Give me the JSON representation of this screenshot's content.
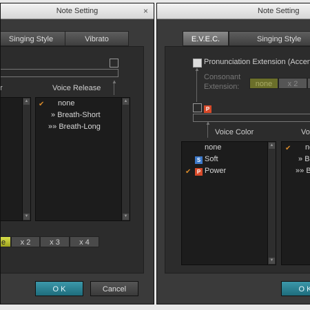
{
  "left_window": {
    "title": "Note Setting",
    "close_label": "×",
    "tabs": [
      {
        "label": "Singing Style"
      },
      {
        "label": "Vibrato"
      }
    ],
    "voice_release_header": "Voice Release",
    "left_list_header": "r",
    "voice_release_items": [
      {
        "prefix": "",
        "label": "none",
        "checked": true
      },
      {
        "prefix": "»",
        "label": "Breath-Short",
        "checked": false
      },
      {
        "prefix": "»»",
        "label": "Breath-Long",
        "checked": false
      }
    ],
    "multiplier_options": [
      {
        "label": "e",
        "selected": true
      },
      {
        "label": "x 2",
        "selected": false
      },
      {
        "label": "x 3",
        "selected": false
      },
      {
        "label": "x 4",
        "selected": false
      }
    ],
    "ok_label": "O K",
    "cancel_label": "Cancel"
  },
  "right_window": {
    "title": "Note Setting",
    "tabs": [
      {
        "label": "E.V.E.C."
      },
      {
        "label": "Singing Style"
      }
    ],
    "pronunciation_label": "Pronunciation Extension (Accen",
    "consonant_label_1": "Consonant",
    "consonant_label_2": "Extension:",
    "consonant_options": [
      {
        "label": "none",
        "selected": true
      },
      {
        "label": "x 2",
        "selected": false
      },
      {
        "label": "",
        "selected": false
      }
    ],
    "p_badge": "P",
    "voice_color_header": "Voice Color",
    "second_header": "Vo",
    "voice_color_items": [
      {
        "badge": "",
        "label": "none",
        "checked": false
      },
      {
        "badge": "S",
        "label": "Soft",
        "checked": false
      },
      {
        "badge": "P",
        "label": "Power",
        "checked": true
      }
    ],
    "second_list_items": [
      {
        "prefix": "",
        "label": "no",
        "checked": true
      },
      {
        "prefix": "»",
        "label": "Br",
        "checked": false
      },
      {
        "prefix": "»»",
        "label": "Br",
        "checked": false
      }
    ],
    "ok_label": "O K"
  },
  "colors": {
    "accent_yellow": "#c9d03a",
    "ok_teal": "#2a8597",
    "check_orange": "#d88a2a",
    "badge_soft": "#3d79c9",
    "badge_power": "#d84a2a"
  }
}
